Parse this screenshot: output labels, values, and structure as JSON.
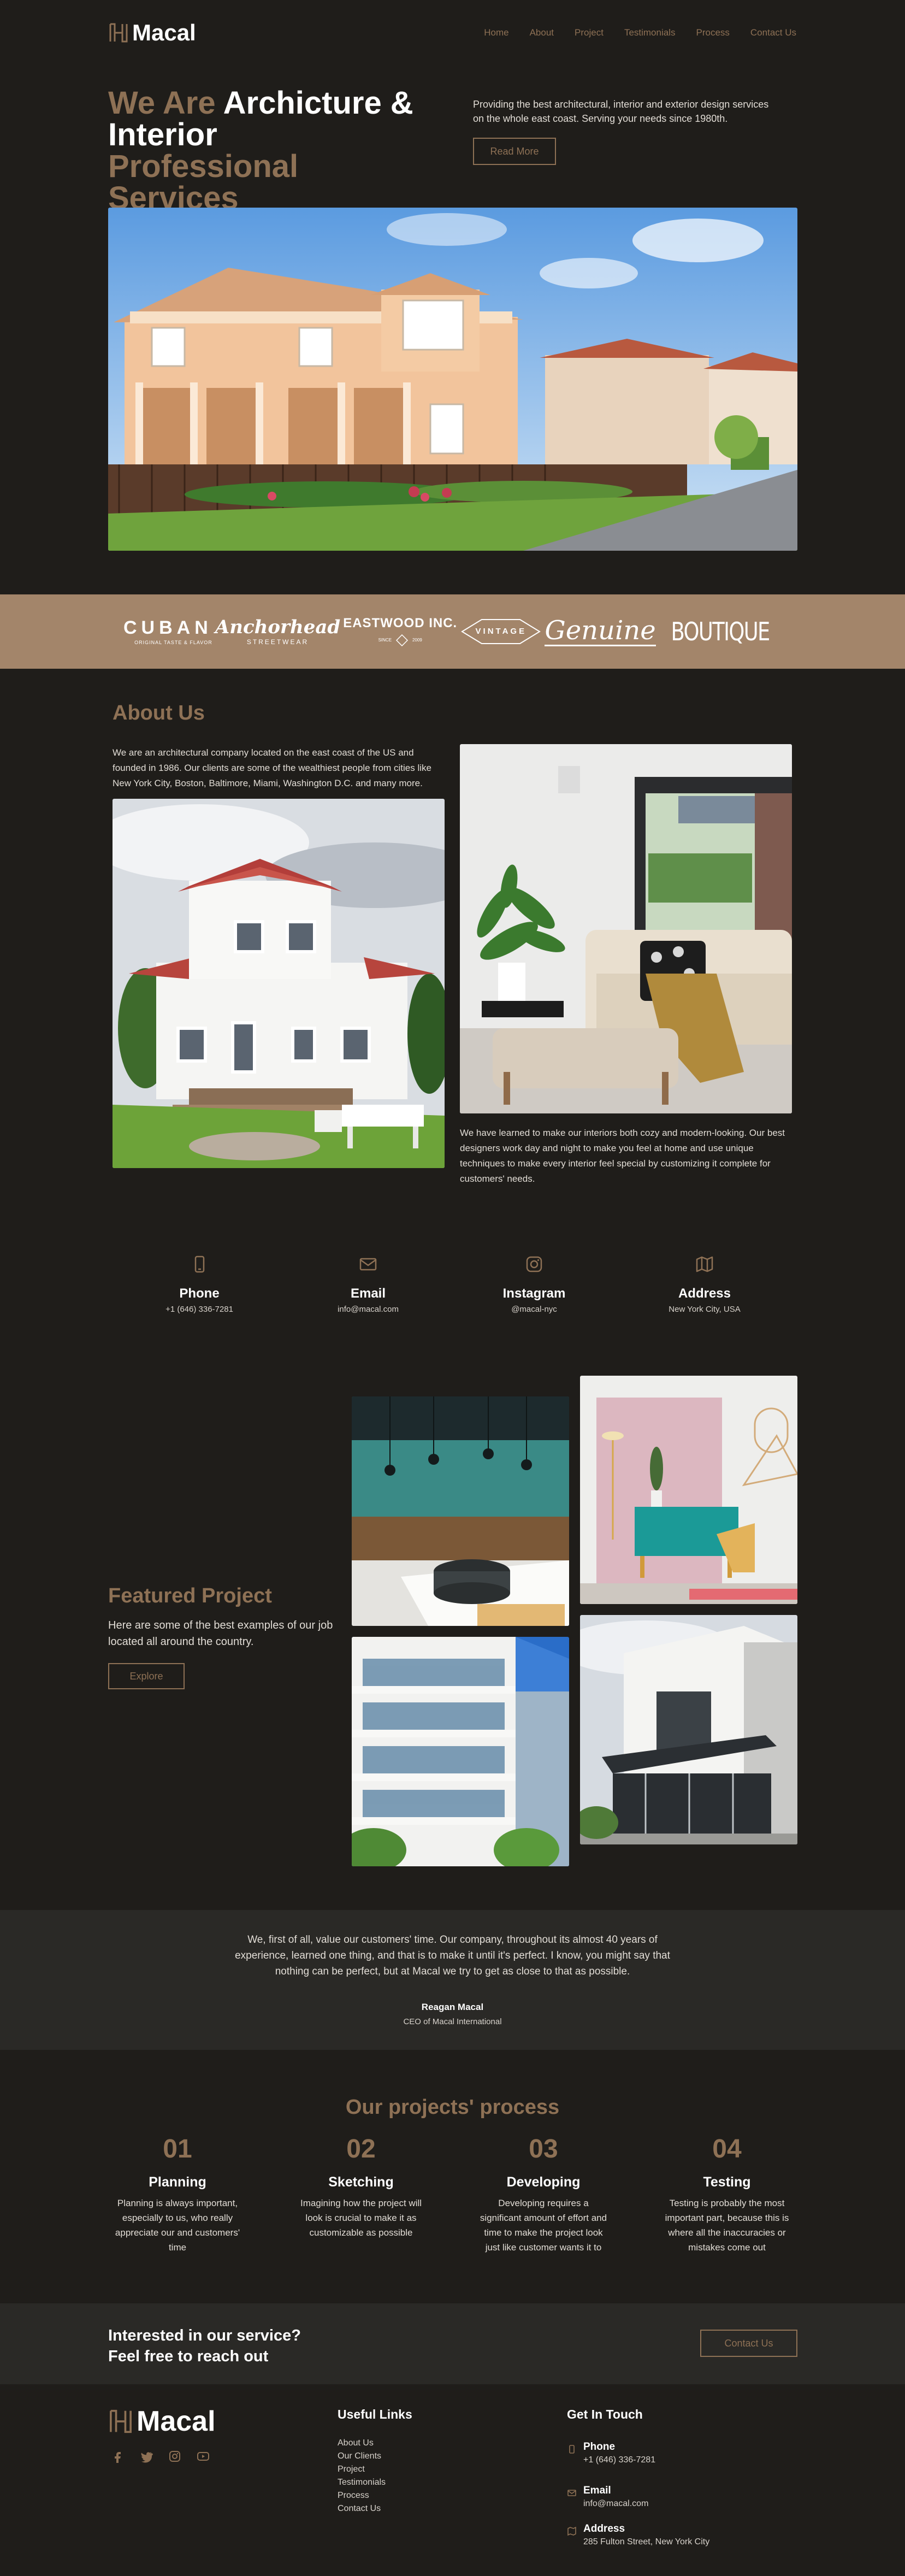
{
  "nav": {
    "brand": "Macal",
    "links": [
      "Home",
      "About",
      "Project",
      "Testimonials",
      "Process",
      "Contact Us"
    ]
  },
  "hero": {
    "title_we_are": "We Are",
    "title_archicture": "Archicture &",
    "title_interior": "Interior",
    "title_professional": "Professional",
    "title_services": "Services",
    "description": "Providing the best architectural, interior and exterior design services on the whole east coast. Serving your needs since 1980th.",
    "button": "Read More"
  },
  "brands": {
    "cuban": "CUBAN",
    "cuban_sub": "ORIGINAL TASTE & FLAVOR",
    "anchorhead": "Anchorhead",
    "anchorhead_sub": "STREETWEAR",
    "eastwood": "EASTWOOD INC.",
    "eastwood_sub_left": "SINCE",
    "eastwood_sub_right": "2009",
    "vintage": "VINTAGE",
    "genuine": "Genuine",
    "boutique": "BOUTIQUE"
  },
  "about": {
    "title": "About Us",
    "paragraph1": "We are an architectural company located on the east coast of the US and founded in 1986. Our clients are some of the wealthiest people from cities like New York City, Boston, Baltimore, Miami, Washington D.C. and many more.",
    "paragraph2": "We have learned to make our interiors both cozy and modern-looking. Our best designers work day and night to make you feel at home and use unique techniques to make every interior feel special by customizing it complete for customers' needs."
  },
  "contacts": [
    {
      "label": "Phone",
      "value": "+1 (646) 336-7281",
      "icon": "phone-icon"
    },
    {
      "label": "Email",
      "value": "info@macal.com",
      "icon": "mail-icon"
    },
    {
      "label": "Instagram",
      "value": "@macal-nyc",
      "icon": "instagram-icon"
    },
    {
      "label": "Address",
      "value": "New York City, USA",
      "icon": "map-icon"
    }
  ],
  "featured": {
    "title": "Featured Project",
    "description": "Here are some of the best examples of our job located all around the country.",
    "button": "Explore"
  },
  "testimonial": {
    "quote": "We, first of all, value our customers' time. Our company, throughout its almost 40 years of experience, learned one thing, and that is to make it until it's perfect. I know, you might say that nothing can be perfect, but at Macal we try to get as close to that as possible.",
    "name": "Reagan Macal",
    "role": "CEO of Macal International"
  },
  "process": {
    "title": "Our projects' process",
    "steps": [
      {
        "num": "01",
        "name": "Planning",
        "desc": "Planning is always important, especially to us, who really appreciate our and customers' time"
      },
      {
        "num": "02",
        "name": "Sketching",
        "desc": "Imagining how the project will look is crucial to make it as customizable as possible"
      },
      {
        "num": "03",
        "name": "Developing",
        "desc": "Developing requires a significant amount of effort and time to make the project look just like customer wants it to"
      },
      {
        "num": "04",
        "name": "Testing",
        "desc": "Testing is probably the most important part, because this is where all the inaccuracies or mistakes come out"
      }
    ]
  },
  "cta": {
    "line1": "Interested in our service?",
    "line2": "Feel free to reach out",
    "button": "Contact Us"
  },
  "footer": {
    "brand": "Macal",
    "socials": [
      "facebook-icon",
      "twitter-icon",
      "instagram-icon",
      "youtube-icon"
    ],
    "links_title": "Useful Links",
    "links": [
      "About Us",
      "Our Clients",
      "Project",
      "Testimonials",
      "Process",
      "Contact Us"
    ],
    "touch_title": "Get In Touch",
    "touch": [
      {
        "label": "Phone",
        "value": "+1 (646) 336-7281",
        "icon": "phone-icon"
      },
      {
        "label": "Email",
        "value": "info@macal.com",
        "icon": "mail-icon"
      },
      {
        "label": "Address",
        "value": "285 Fulton Street, New York City",
        "icon": "map-icon"
      }
    ]
  },
  "colors": {
    "background": "#1f1d1a",
    "accent": "#8e7155",
    "brand_bar": "#a3856a",
    "panel": "#2a2926"
  }
}
